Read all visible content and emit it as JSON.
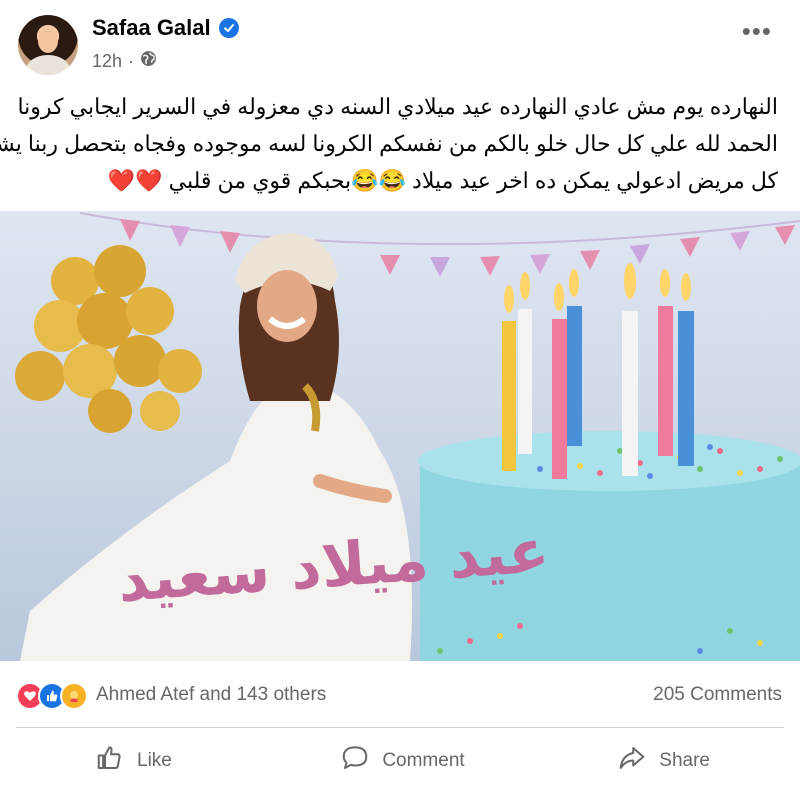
{
  "post": {
    "author": "Safaa Galal",
    "time": "12h",
    "text_lines": [
      "النهارده يوم مش عادي النهارده عيد ميلادي السنه دي معزوله في السرير ايجابي كرونا",
      "الحمد لله علي كل حال خلو بالكم من نفسكم الكرونا لسه موجوده وفجاه بتحصل ربنا يشفي",
      "كل مريض ادعولي يمكن ده اخر عيد ميلاد 😂😂بحبكم قوي من قلبي ❤️❤️"
    ],
    "image_caption": "عيد ميلاد سعيد"
  },
  "reactions": {
    "summary": "Ahmed Atef and 143 others",
    "comments": "205 Comments",
    "icons": [
      "love-icon",
      "like-icon",
      "care-icon"
    ]
  },
  "actions": {
    "like": "Like",
    "comment": "Comment",
    "share": "Share"
  },
  "colors": {
    "brand_blue": "#1b74e4",
    "muted_text": "#65676b",
    "love_red": "#f33e58"
  }
}
